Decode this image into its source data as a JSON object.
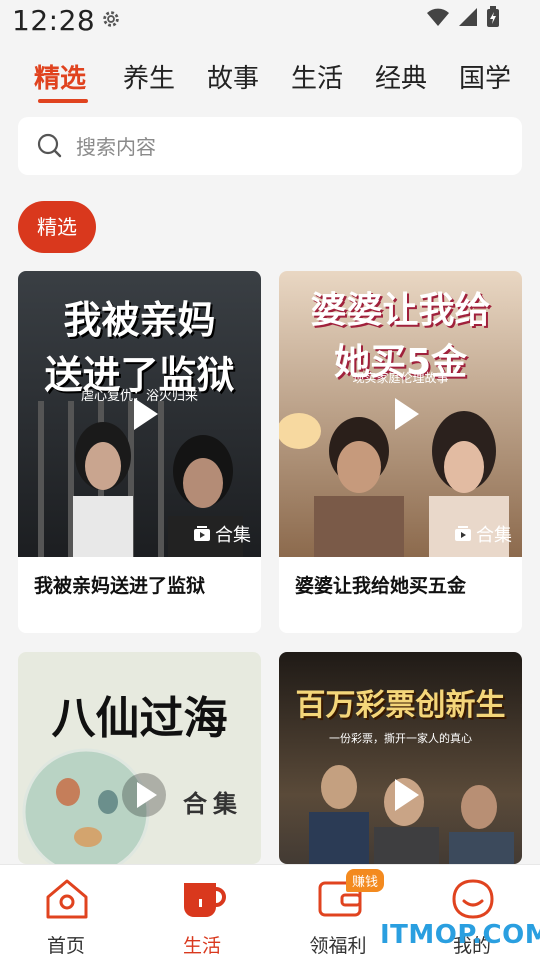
{
  "status_bar": {
    "time": "12:28"
  },
  "tabs": [
    {
      "label": "精选",
      "active": true
    },
    {
      "label": "养生",
      "active": false
    },
    {
      "label": "故事",
      "active": false
    },
    {
      "label": "生活",
      "active": false
    },
    {
      "label": "经典",
      "active": false
    },
    {
      "label": "国学",
      "active": false
    }
  ],
  "search": {
    "placeholder": "搜索内容"
  },
  "filter_chip": {
    "label": "精选"
  },
  "cards": [
    {
      "title": "我被亲妈送进了监狱",
      "poster_line1": "我被亲妈",
      "poster_line2": "送进了监狱",
      "poster_sub": "虐心复仇：浴火归来",
      "collection_label": "合集"
    },
    {
      "title": "婆婆让我给她买五金",
      "poster_line1": "婆婆让我给",
      "poster_line2": "她买5金",
      "poster_sub": "现实家庭伦理故事",
      "collection_label": "合集"
    },
    {
      "title": "",
      "poster_line1": "八仙过海",
      "poster_side": "合集"
    },
    {
      "title": "",
      "poster_line1": "百万彩票创新生",
      "poster_sub": "一份彩票，撕开一家人的真心"
    }
  ],
  "bottom_nav": [
    {
      "label": "首页",
      "active": false,
      "icon": "home-icon"
    },
    {
      "label": "生活",
      "active": true,
      "icon": "cup-icon"
    },
    {
      "label": "领福利",
      "active": false,
      "icon": "wallet-icon",
      "badge": "赚钱"
    },
    {
      "label": "我的",
      "active": false,
      "icon": "smile-icon"
    }
  ],
  "watermark": "ITMOP.COM",
  "colors": {
    "accent": "#e0431f",
    "chip": "#d9381d",
    "badge": "#f38a1f"
  }
}
